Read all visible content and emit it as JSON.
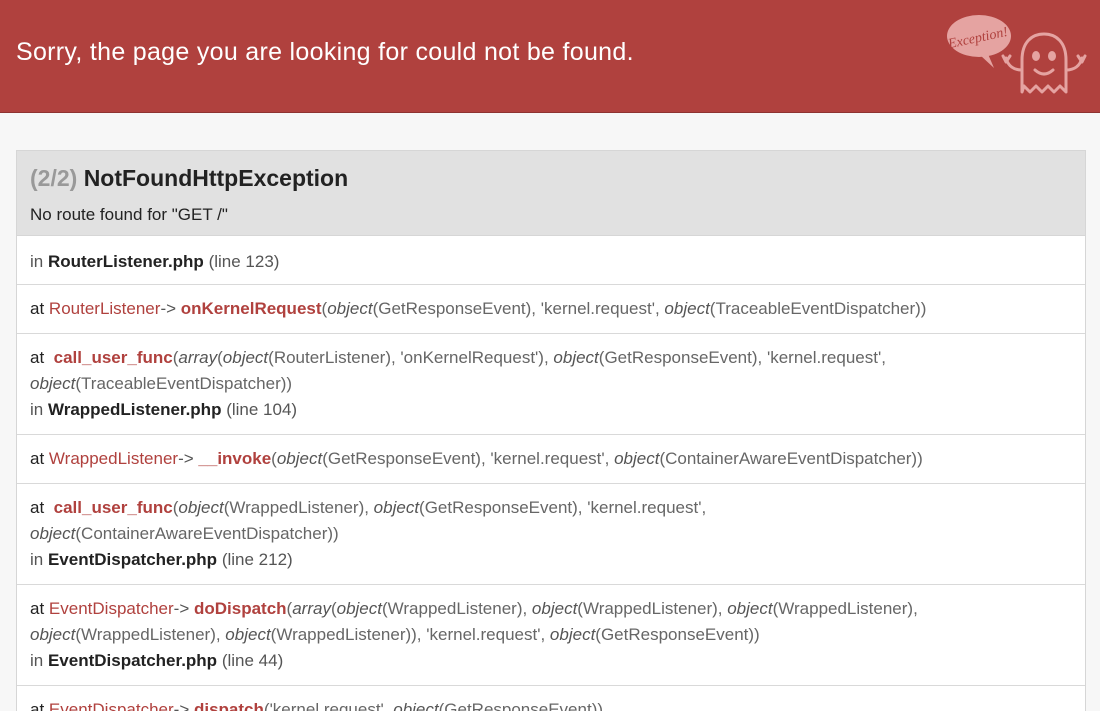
{
  "header": {
    "title": "Sorry, the page you are looking for could not be found.",
    "logo_text": "Exception!"
  },
  "exception": {
    "count": "(2/2)",
    "class": "NotFoundHttpException",
    "message": "No route found for \"GET /\""
  },
  "trace": [
    {
      "kind": "in",
      "in_label": "in",
      "file": "RouterListener.php",
      "line": "(line 123)"
    },
    {
      "kind": "call",
      "at_label": "at",
      "class": "RouterListener",
      "arrow": "->",
      "function": "onKernelRequest",
      "args_line1": "object(GetResponseEvent), 'kernel.request', object(TraceableEventDispatcher))",
      "args_line2": ""
    },
    {
      "kind": "call_with_file",
      "at_label": "at",
      "function": "call_user_func",
      "args_line1": "array(object(RouterListener), 'onKernelRequest'), object(GetResponseEvent), 'kernel.request',",
      "args_line2": "object(TraceableEventDispatcher))",
      "in_label": "in",
      "file": "WrappedListener.php",
      "line": "(line 104)"
    },
    {
      "kind": "call",
      "at_label": "at",
      "class": "WrappedListener",
      "arrow": "->",
      "function": "__invoke",
      "args_line1": "object(GetResponseEvent), 'kernel.request', object(ContainerAwareEventDispatcher))",
      "args_line2": ""
    },
    {
      "kind": "call_with_file",
      "at_label": "at",
      "function": "call_user_func",
      "args_line1": "object(WrappedListener), object(GetResponseEvent), 'kernel.request',",
      "args_line2": "object(ContainerAwareEventDispatcher))",
      "in_label": "in",
      "file": "EventDispatcher.php",
      "line": "(line 212)"
    },
    {
      "kind": "call_with_file",
      "at_label": "at",
      "class": "EventDispatcher",
      "arrow": "->",
      "function": "doDispatch",
      "args_line1": "array(object(WrappedListener), object(WrappedListener), object(WrappedListener),",
      "args_line2": "object(WrappedListener), object(WrappedListener)), 'kernel.request', object(GetResponseEvent))",
      "in_label": "in",
      "file": "EventDispatcher.php",
      "line": "(line 44)"
    },
    {
      "kind": "call",
      "at_label": "at",
      "class": "EventDispatcher",
      "arrow": "->",
      "function": "dispatch",
      "args_line1": "'kernel.request', object(GetResponseEvent))",
      "args_line2": ""
    }
  ],
  "colors": {
    "header_bg": "#b0413e",
    "accent": "#b0413e",
    "panel_head_bg": "#e1e1e1"
  }
}
